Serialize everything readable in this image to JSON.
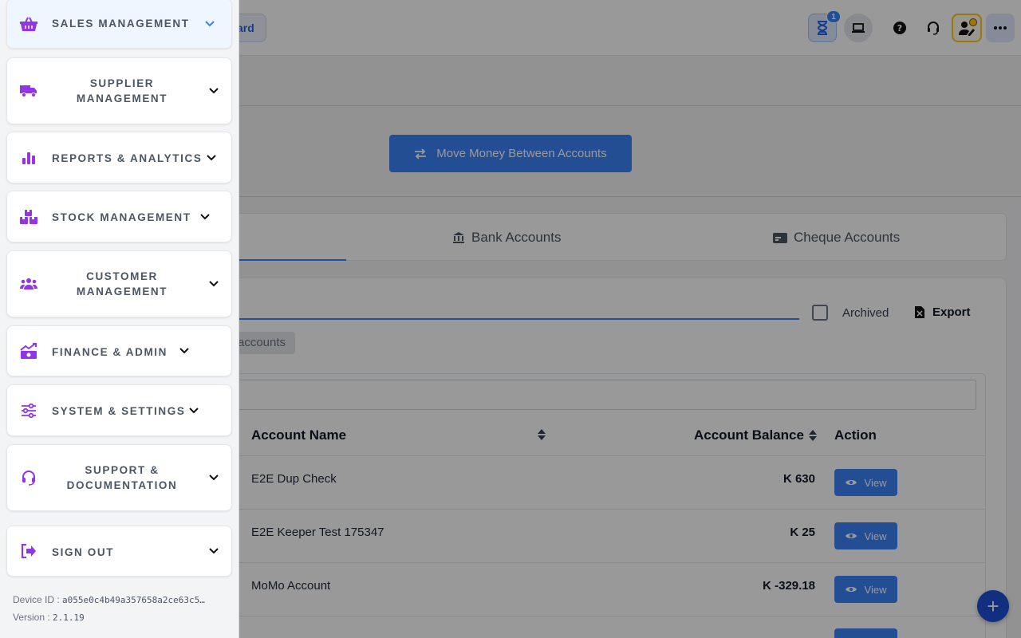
{
  "header": {
    "dashboard_fragment": "ard",
    "notification_count": "1"
  },
  "main": {
    "move_money_label": "Move Money Between Accounts",
    "tabs": [
      {
        "label": "Bank Accounts"
      },
      {
        "label": "Cheque Accounts"
      }
    ],
    "archived_label": "Archived",
    "export_label": "Export",
    "filter_chip": "accounts",
    "table": {
      "headers": {
        "name": "Account Name",
        "balance": "Account Balance",
        "action": "Action"
      },
      "rows": [
        {
          "name": "E2E Dup Check",
          "balance": "K 630",
          "action": "View"
        },
        {
          "name": "E2E Keeper Test 175347",
          "balance": "K 25",
          "action": "View"
        },
        {
          "name": "MoMo Account",
          "balance": "K -329.18",
          "action": "View"
        }
      ]
    },
    "fab_label": "+"
  },
  "sidebar": {
    "items": [
      {
        "label": "SALES MANAGEMENT",
        "icon": "basket-icon"
      },
      {
        "label": "SUPPLIER MANAGEMENT",
        "icon": "truck-icon"
      },
      {
        "label": "REPORTS & ANALYTICS",
        "icon": "bar-chart-icon"
      },
      {
        "label": "STOCK MANAGEMENT",
        "icon": "boxes-icon"
      },
      {
        "label": "CUSTOMER MANAGEMENT",
        "icon": "users-icon"
      },
      {
        "label": "FINANCE & ADMIN",
        "icon": "money-chart-icon"
      },
      {
        "label": "SYSTEM & SETTINGS",
        "icon": "sliders-icon"
      },
      {
        "label": "SUPPORT & DOCUMENTATION",
        "icon": "headset-icon"
      },
      {
        "label": "SIGN OUT",
        "icon": "sign-out-icon"
      }
    ],
    "device_label": "Device ID :",
    "device_id": "a055e0c4b49a357658a2ce63c5…",
    "version_label": "Version :",
    "version": "2.1.19"
  },
  "colors": {
    "accent": "#3b82f6",
    "icon_purple": "#9333ea",
    "overlay": "rgba(0,0,0,0.4)"
  }
}
